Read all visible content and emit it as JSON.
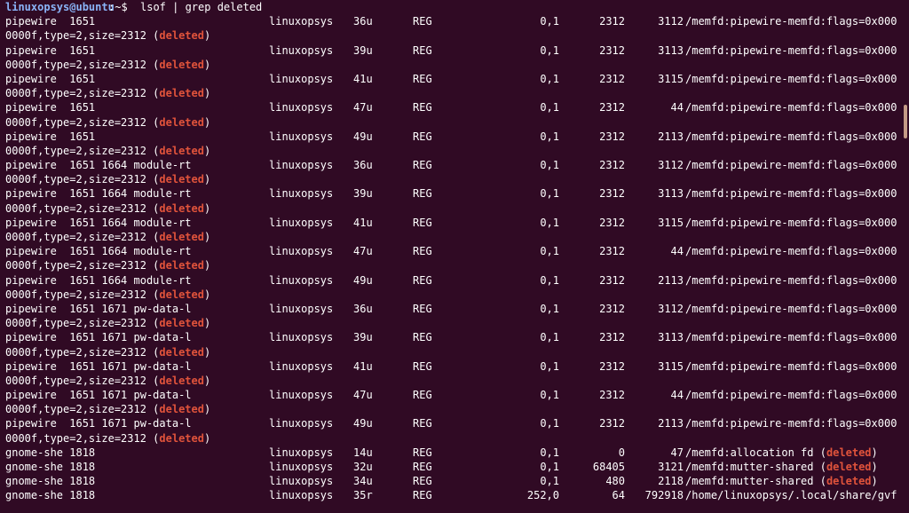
{
  "prompt": {
    "user_host": "linuxopsys@ubuntu",
    "path_and_symbol": ":~$ ",
    "command": "lsof | grep deleted"
  },
  "deleted_label": "deleted",
  "rows": [
    {
      "cmd": "pipewire  1651",
      "user": "linuxopsys",
      "fd": "36u",
      "type": "REG",
      "dev": "0,1",
      "size": "2312",
      "node": "3112",
      "name": "/memfd:pipewire-memfd:flags=0x000",
      "cont": "0000f,type=2,size=2312 ("
    },
    {
      "cmd": "pipewire  1651",
      "user": "linuxopsys",
      "fd": "39u",
      "type": "REG",
      "dev": "0,1",
      "size": "2312",
      "node": "3113",
      "name": "/memfd:pipewire-memfd:flags=0x000",
      "cont": "0000f,type=2,size=2312 ("
    },
    {
      "cmd": "pipewire  1651",
      "user": "linuxopsys",
      "fd": "41u",
      "type": "REG",
      "dev": "0,1",
      "size": "2312",
      "node": "3115",
      "name": "/memfd:pipewire-memfd:flags=0x000",
      "cont": "0000f,type=2,size=2312 ("
    },
    {
      "cmd": "pipewire  1651",
      "user": "linuxopsys",
      "fd": "47u",
      "type": "REG",
      "dev": "0,1",
      "size": "2312",
      "node": "44",
      "name": "/memfd:pipewire-memfd:flags=0x000",
      "cont": "0000f,type=2,size=2312 ("
    },
    {
      "cmd": "pipewire  1651",
      "user": "linuxopsys",
      "fd": "49u",
      "type": "REG",
      "dev": "0,1",
      "size": "2312",
      "node": "2113",
      "name": "/memfd:pipewire-memfd:flags=0x000",
      "cont": "0000f,type=2,size=2312 ("
    },
    {
      "cmd": "pipewire  1651 1664 module-rt",
      "user": "linuxopsys",
      "fd": "36u",
      "type": "REG",
      "dev": "0,1",
      "size": "2312",
      "node": "3112",
      "name": "/memfd:pipewire-memfd:flags=0x000",
      "cont": "0000f,type=2,size=2312 ("
    },
    {
      "cmd": "pipewire  1651 1664 module-rt",
      "user": "linuxopsys",
      "fd": "39u",
      "type": "REG",
      "dev": "0,1",
      "size": "2312",
      "node": "3113",
      "name": "/memfd:pipewire-memfd:flags=0x000",
      "cont": "0000f,type=2,size=2312 ("
    },
    {
      "cmd": "pipewire  1651 1664 module-rt",
      "user": "linuxopsys",
      "fd": "41u",
      "type": "REG",
      "dev": "0,1",
      "size": "2312",
      "node": "3115",
      "name": "/memfd:pipewire-memfd:flags=0x000",
      "cont": "0000f,type=2,size=2312 ("
    },
    {
      "cmd": "pipewire  1651 1664 module-rt",
      "user": "linuxopsys",
      "fd": "47u",
      "type": "REG",
      "dev": "0,1",
      "size": "2312",
      "node": "44",
      "name": "/memfd:pipewire-memfd:flags=0x000",
      "cont": "0000f,type=2,size=2312 ("
    },
    {
      "cmd": "pipewire  1651 1664 module-rt",
      "user": "linuxopsys",
      "fd": "49u",
      "type": "REG",
      "dev": "0,1",
      "size": "2312",
      "node": "2113",
      "name": "/memfd:pipewire-memfd:flags=0x000",
      "cont": "0000f,type=2,size=2312 ("
    },
    {
      "cmd": "pipewire  1651 1671 pw-data-l",
      "user": "linuxopsys",
      "fd": "36u",
      "type": "REG",
      "dev": "0,1",
      "size": "2312",
      "node": "3112",
      "name": "/memfd:pipewire-memfd:flags=0x000",
      "cont": "0000f,type=2,size=2312 ("
    },
    {
      "cmd": "pipewire  1651 1671 pw-data-l",
      "user": "linuxopsys",
      "fd": "39u",
      "type": "REG",
      "dev": "0,1",
      "size": "2312",
      "node": "3113",
      "name": "/memfd:pipewire-memfd:flags=0x000",
      "cont": "0000f,type=2,size=2312 ("
    },
    {
      "cmd": "pipewire  1651 1671 pw-data-l",
      "user": "linuxopsys",
      "fd": "41u",
      "type": "REG",
      "dev": "0,1",
      "size": "2312",
      "node": "3115",
      "name": "/memfd:pipewire-memfd:flags=0x000",
      "cont": "0000f,type=2,size=2312 ("
    },
    {
      "cmd": "pipewire  1651 1671 pw-data-l",
      "user": "linuxopsys",
      "fd": "47u",
      "type": "REG",
      "dev": "0,1",
      "size": "2312",
      "node": "44",
      "name": "/memfd:pipewire-memfd:flags=0x000",
      "cont": "0000f,type=2,size=2312 ("
    },
    {
      "cmd": "pipewire  1651 1671 pw-data-l",
      "user": "linuxopsys",
      "fd": "49u",
      "type": "REG",
      "dev": "0,1",
      "size": "2312",
      "node": "2113",
      "name": "/memfd:pipewire-memfd:flags=0x000",
      "cont": "0000f,type=2,size=2312 ("
    },
    {
      "cmd": "gnome-she 1818",
      "user": "linuxopsys",
      "fd": "14u",
      "type": "REG",
      "dev": "0,1",
      "size": "0",
      "node": "47",
      "name": "/memfd:allocation fd (",
      "name_deleted": true
    },
    {
      "cmd": "gnome-she 1818",
      "user": "linuxopsys",
      "fd": "32u",
      "type": "REG",
      "dev": "0,1",
      "size": "68405",
      "node": "3121",
      "name": "/memfd:mutter-shared (",
      "name_deleted": true
    },
    {
      "cmd": "gnome-she 1818",
      "user": "linuxopsys",
      "fd": "34u",
      "type": "REG",
      "dev": "0,1",
      "size": "480",
      "node": "2118",
      "name": "/memfd:mutter-shared (",
      "name_deleted": true
    },
    {
      "cmd": "gnome-she 1818",
      "user": "linuxopsys",
      "fd": "35r",
      "type": "REG",
      "dev": "252,0",
      "size": "64",
      "node": "792918",
      "name": "/home/linuxopsys/.local/share/gvf"
    }
  ],
  "colors": {
    "background": "#300a24",
    "prompt_user": "#8ab4f8",
    "deleted": "#e0533b",
    "scrollbar": "#c49a86"
  }
}
